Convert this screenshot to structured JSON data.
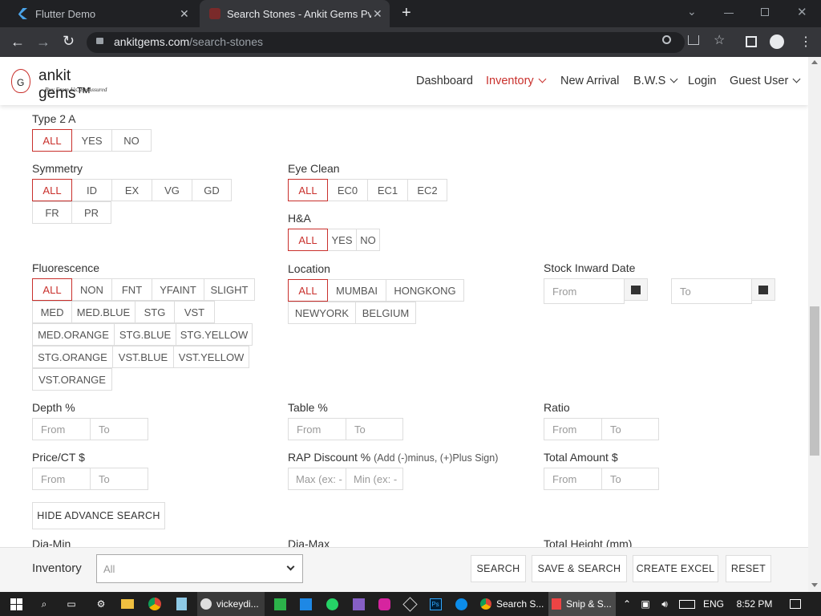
{
  "browser": {
    "tabs": [
      {
        "label": "Flutter Demo"
      },
      {
        "label": "Search Stones - Ankit Gems Pvt. L"
      }
    ],
    "url_domain": "ankitgems.com",
    "url_path": "/search-stones"
  },
  "header": {
    "brand": "ankit gems™",
    "tagline": "Buy From Us, Be Assured",
    "nav": {
      "dashboard": "Dashboard",
      "inventory": "Inventory",
      "new_arrival": "New Arrival",
      "bws": "B.W.S",
      "login": "Login",
      "guest": "Guest User"
    }
  },
  "form": {
    "type2a": {
      "label": "Type 2 A",
      "options": [
        "ALL",
        "YES",
        "NO"
      ]
    },
    "symmetry": {
      "label": "Symmetry",
      "options": [
        "ALL",
        "ID",
        "EX",
        "VG",
        "GD",
        "FR",
        "PR"
      ]
    },
    "eye_clean": {
      "label": "Eye Clean",
      "options": [
        "ALL",
        "EC0",
        "EC1",
        "EC2"
      ]
    },
    "ha": {
      "label": "H&A",
      "options": [
        "ALL",
        "YES",
        "NO"
      ]
    },
    "fluorescence": {
      "label": "Fluorescence",
      "options": [
        "ALL",
        "NON",
        "FNT",
        "YFAINT",
        "SLIGHT",
        "MED",
        "MED.BLUE",
        "STG",
        "VST",
        "MED.ORANGE",
        "STG.BLUE",
        "STG.YELLOW",
        "STG.ORANGE",
        "VST.BLUE",
        "VST.YELLOW",
        "VST.ORANGE"
      ]
    },
    "location": {
      "label": "Location",
      "options": [
        "ALL",
        "MUMBAI",
        "HONGKONG",
        "NEWYORK",
        "BELGIUM"
      ]
    },
    "stock_inward": {
      "label": "Stock Inward Date",
      "from": "From",
      "to": "To"
    },
    "depth": {
      "label": "Depth %",
      "from": "From",
      "to": "To"
    },
    "table": {
      "label": "Table %",
      "from": "From",
      "to": "To"
    },
    "ratio": {
      "label": "Ratio",
      "from": "From",
      "to": "To"
    },
    "price": {
      "label": "Price/CT $",
      "from": "From",
      "to": "To"
    },
    "rap": {
      "label": "RAP Discount %",
      "hint": "(Add (-)minus, (+)Plus Sign)",
      "max": "Max (ex: -",
      "min": "Min (ex: -"
    },
    "total_amount": {
      "label": "Total Amount $",
      "from": "From",
      "to": "To"
    },
    "hide_advance": "HIDE ADVANCE SEARCH",
    "dia_min": "Dia-Min",
    "dia_max": "Dia-Max",
    "total_height": "Total Height (mm)"
  },
  "footer": {
    "label": "Inventory",
    "select_value": "All",
    "search": "SEARCH",
    "save_search": "SAVE & SEARCH",
    "create_excel": "CREATE EXCEL",
    "reset": "RESET"
  },
  "taskbar": {
    "app1": "vickeydi...",
    "app2": "Search S...",
    "app3": "Snip & S...",
    "lang": "ENG",
    "time": "8:52 PM"
  },
  "colors": {
    "accent": "#c9302c",
    "chrome_dark": "#202124",
    "chrome_mid": "#35363a"
  }
}
